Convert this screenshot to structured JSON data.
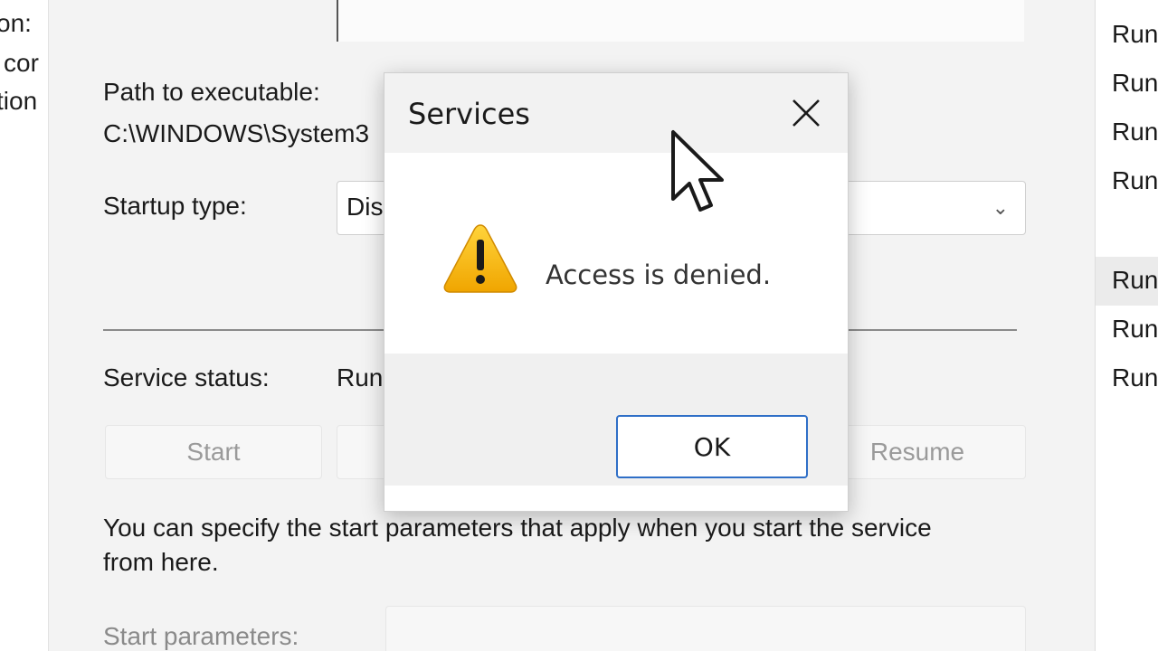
{
  "left_panel": {
    "lines": [
      "on:",
      "cor",
      "tion"
    ]
  },
  "properties": {
    "path_label": "Path to executable:",
    "path_value": "C:\\WINDOWS\\System3",
    "startup_type_label": "Startup type:",
    "startup_type_value": "Dis",
    "service_status_label": "Service status:",
    "service_status_value": "Run",
    "buttons": {
      "start": "Start",
      "resume": "Resume"
    },
    "start_params_help": "You can specify the start parameters that apply when you start the service",
    "start_params_help_2": "from here.",
    "start_params_label": "Start parameters:"
  },
  "status_column": {
    "items": [
      "Run",
      "Run",
      "Run",
      "Run",
      "Run",
      "Run",
      "Run"
    ]
  },
  "dialog": {
    "title": "Services",
    "message": "Access is denied.",
    "ok_label": "OK",
    "close_icon": "close-icon",
    "warning_icon": "warning-icon"
  },
  "colors": {
    "accent_border": "#2f6fc7",
    "warning_yellow": "#f5b400"
  }
}
